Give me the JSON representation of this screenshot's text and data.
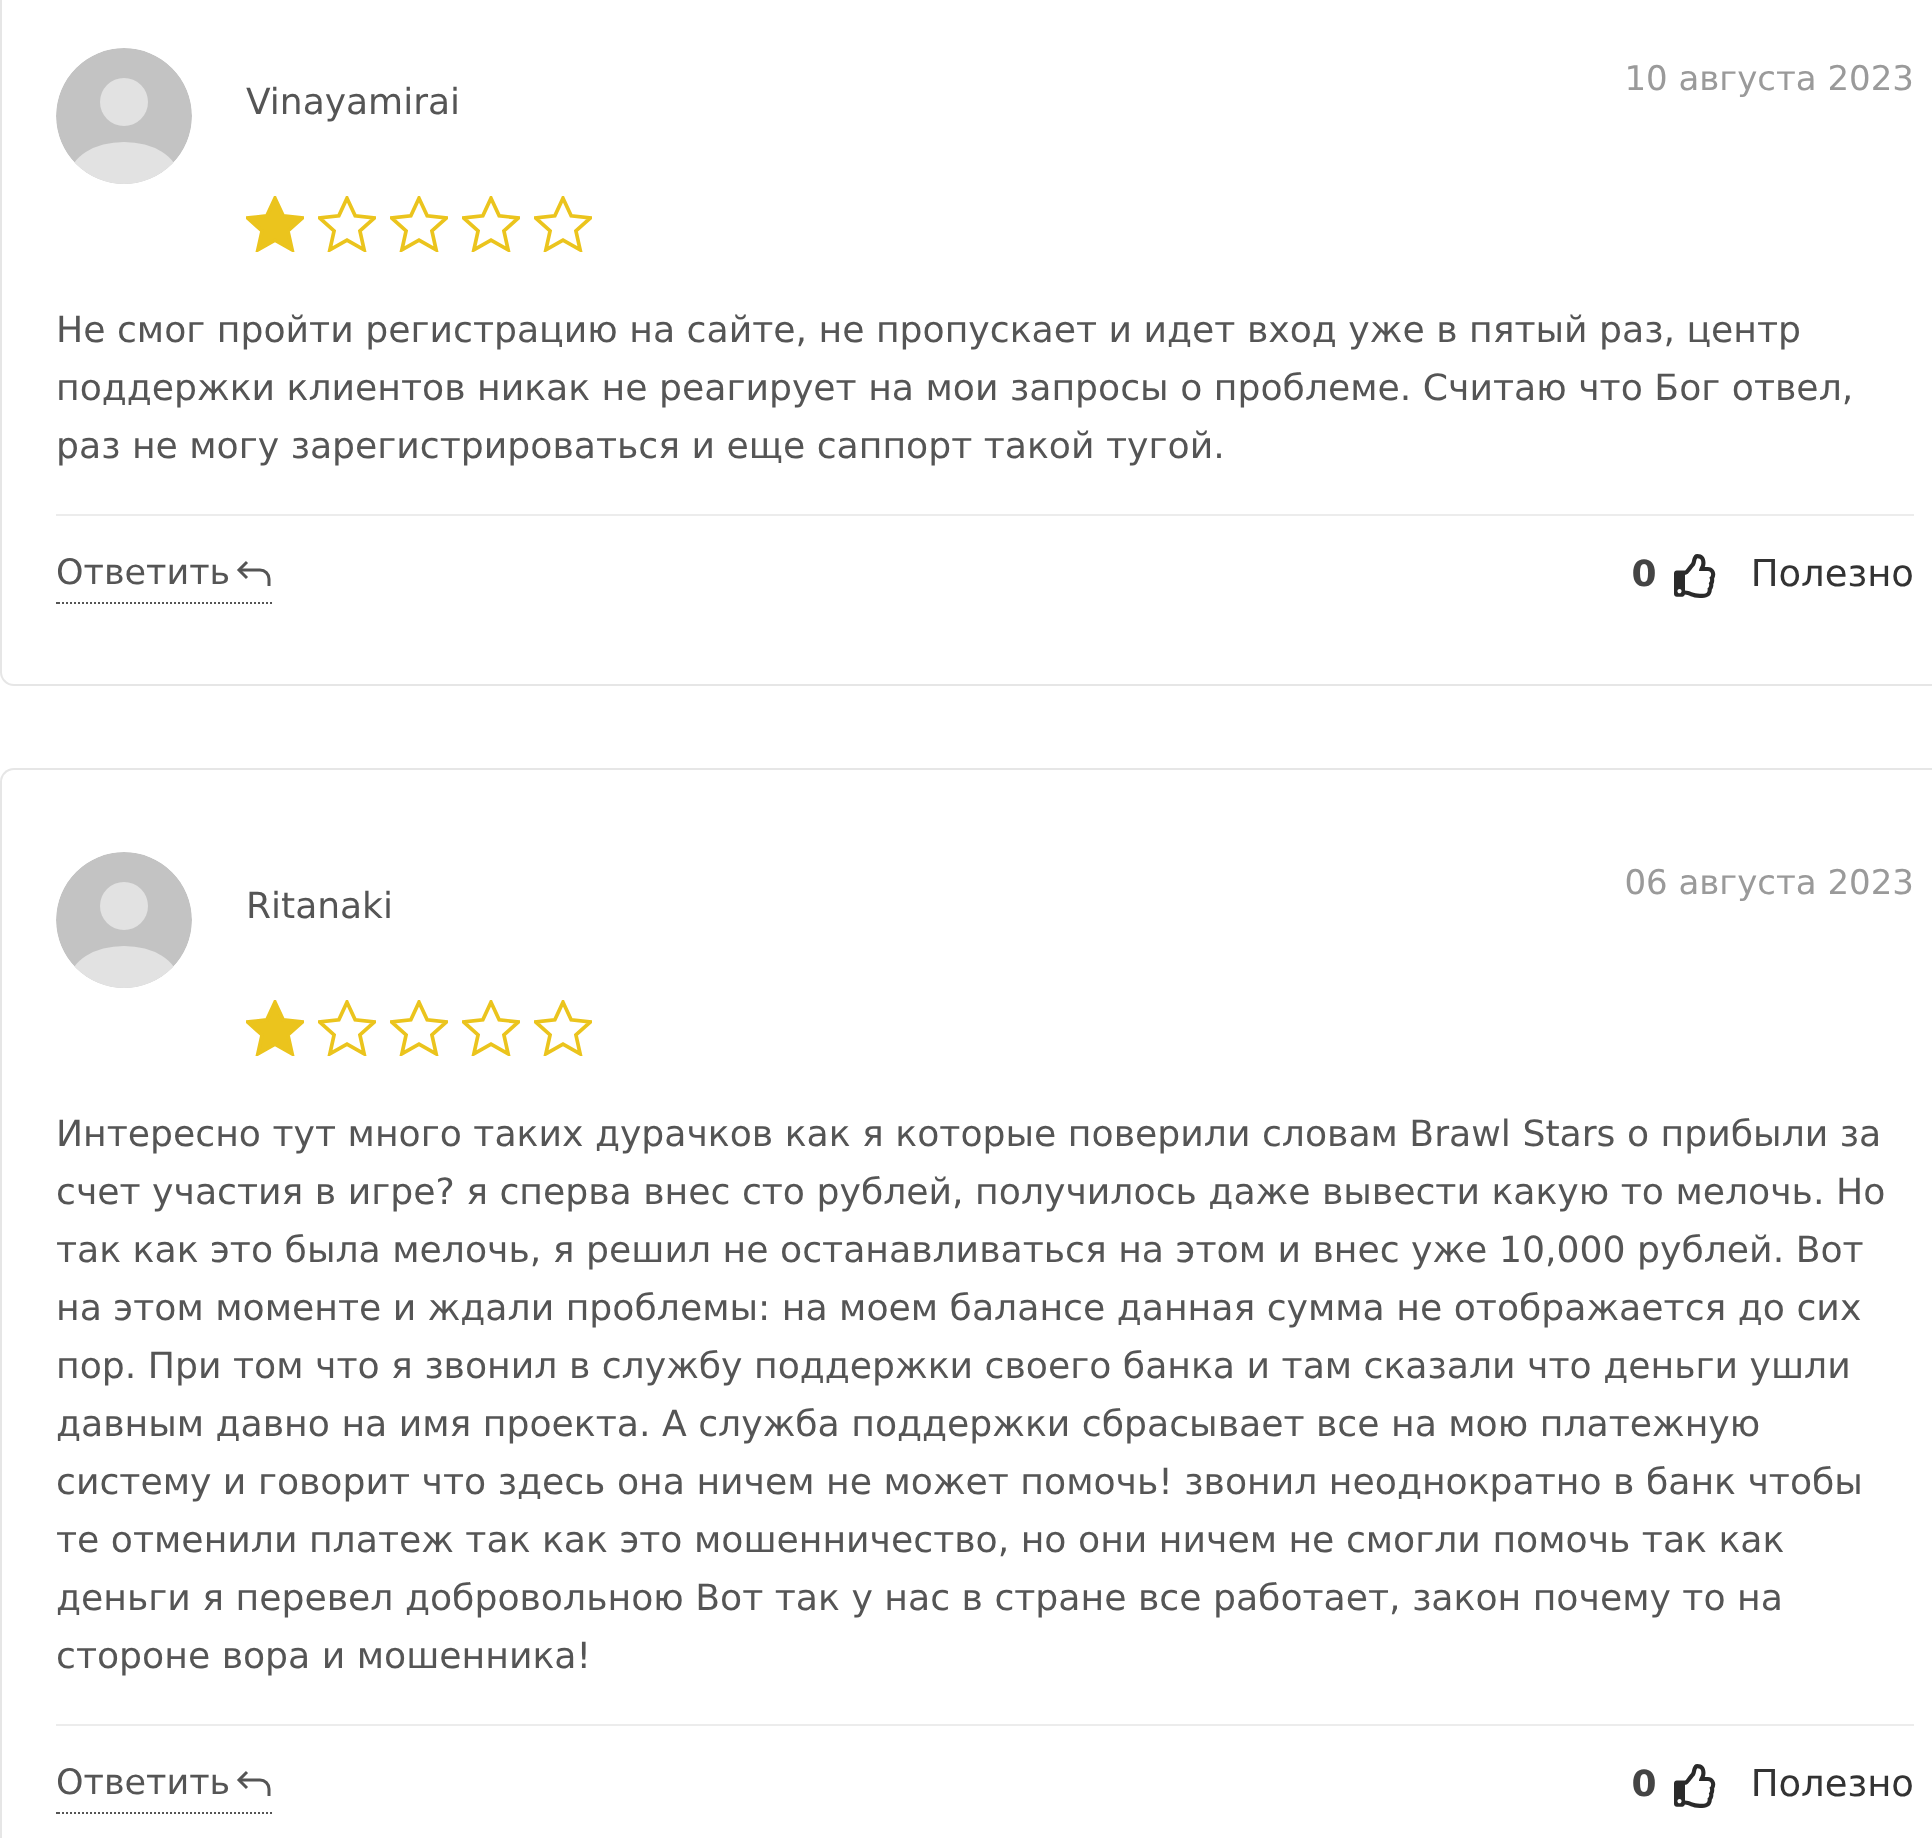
{
  "reviews": [
    {
      "author": "Vinayamirai",
      "date": "10 августа 2023",
      "stars": 1,
      "text": "Не смог пройти регистрацию на сайте, не пропускает и идет вход уже в пятый раз, центр поддержки клиентов никак не реагирует на мои запросы о проблеме. Считаю что Бог отвел, раз не могу зарегистрироваться и еще саппорт такой тугой.",
      "reply_label": "Ответить",
      "likes": "0",
      "helpful_label": "Полезно"
    },
    {
      "author": "Ritanaki",
      "date": "06 августа 2023",
      "stars": 1,
      "text": "Интересно тут много таких дурачков как я которые поверили словам Brawl Stars о прибыли за счет участия в игре? я сперва внес сто рублей, получилось даже вывести какую то мелочь. Но так как это была мелочь, я решил не останавливаться на этом и внес уже 10,000 рублей. Вот на этом моменте и ждали проблемы: на моем балансе данная сумма не отображается до сих пор. При том что я звонил в службу поддержки своего банка и там сказали что деньги ушли давным давно на имя проекта. А служба поддержки сбрасывает все на мою платежную систему и говорит что здесь она ничем не может помочь! звонил неоднократно в банк чтобы те отменили платеж так как это мошенничество, но они ничем не смогли помочь так как деньги я перевел добровольною Вот так у нас в стране все работает, закон почему то на стороне вора и мошенника!",
      "reply_label": "Ответить",
      "likes": "0",
      "helpful_label": "Полезно"
    }
  ]
}
